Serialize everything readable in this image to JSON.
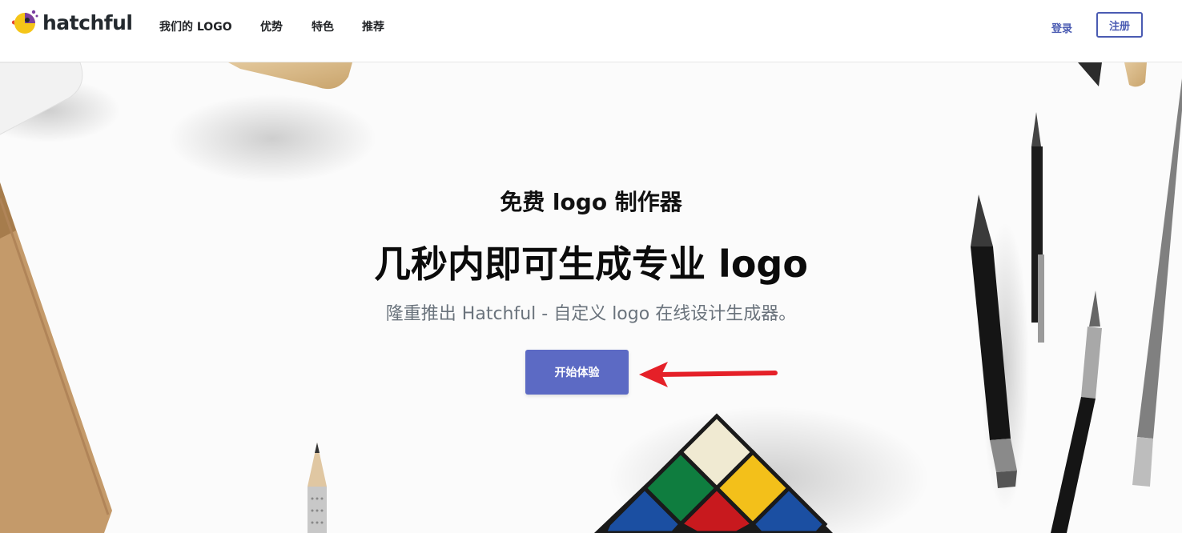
{
  "nav": {
    "brand": "hatchful",
    "links": [
      "我们的 LOGO",
      "优势",
      "特色",
      "推荐"
    ],
    "login": "登录",
    "signup": "注册"
  },
  "hero": {
    "subtitle": "免费 logo 制作器",
    "title": "几秒内即可生成专业 logo",
    "description": "隆重推出 Hatchful - 自定义 logo 在线设计生成器。",
    "cta": "开始体验"
  },
  "colors": {
    "accent": "#5c6ac4",
    "nav_link_blue": "#4a5bb2",
    "annotation_arrow": "#e52028"
  },
  "icons": {
    "brand_logo": "hatchful-bird-icon",
    "annotation": "red-arrow-icon"
  }
}
